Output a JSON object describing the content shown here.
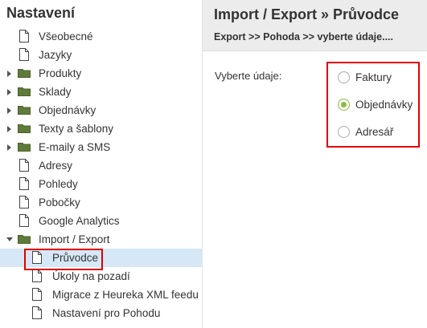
{
  "sidebar": {
    "title": "Nastavení",
    "items": [
      {
        "label": "Všeobecné",
        "type": "page"
      },
      {
        "label": "Jazyky",
        "type": "page"
      },
      {
        "label": "Produkty",
        "type": "folder"
      },
      {
        "label": "Sklady",
        "type": "folder"
      },
      {
        "label": "Objednávky",
        "type": "folder"
      },
      {
        "label": "Texty a šablony",
        "type": "folder"
      },
      {
        "label": "E-maily a SMS",
        "type": "folder"
      },
      {
        "label": "Adresy",
        "type": "page"
      },
      {
        "label": "Pohledy",
        "type": "page"
      },
      {
        "label": "Pobočky",
        "type": "page"
      },
      {
        "label": "Google Analytics",
        "type": "page"
      },
      {
        "label": "Import / Export",
        "type": "folder-open"
      },
      {
        "label": "Průvodce",
        "type": "page",
        "selected": true
      },
      {
        "label": "Úkoly na pozadí",
        "type": "page"
      },
      {
        "label": "Migrace z Heureka XML feedu",
        "type": "page"
      },
      {
        "label": "Nastavení pro Pohodu",
        "type": "page"
      }
    ]
  },
  "main": {
    "title": "Import / Export » Průvodce",
    "breadcrumb": "Export >> Pohoda >> vyberte údaje....",
    "field_label": "Vyberte údaje:",
    "options": [
      {
        "label": "Faktury",
        "checked": false
      },
      {
        "label": "Objednávky",
        "checked": true
      },
      {
        "label": "Adresář",
        "checked": false
      }
    ]
  },
  "colors": {
    "accent": "#8bbd3c",
    "highlight": "#e00000",
    "folder": "#5f7a3a",
    "selected_bg": "#d6e8f5",
    "header_bg": "#ececec"
  }
}
